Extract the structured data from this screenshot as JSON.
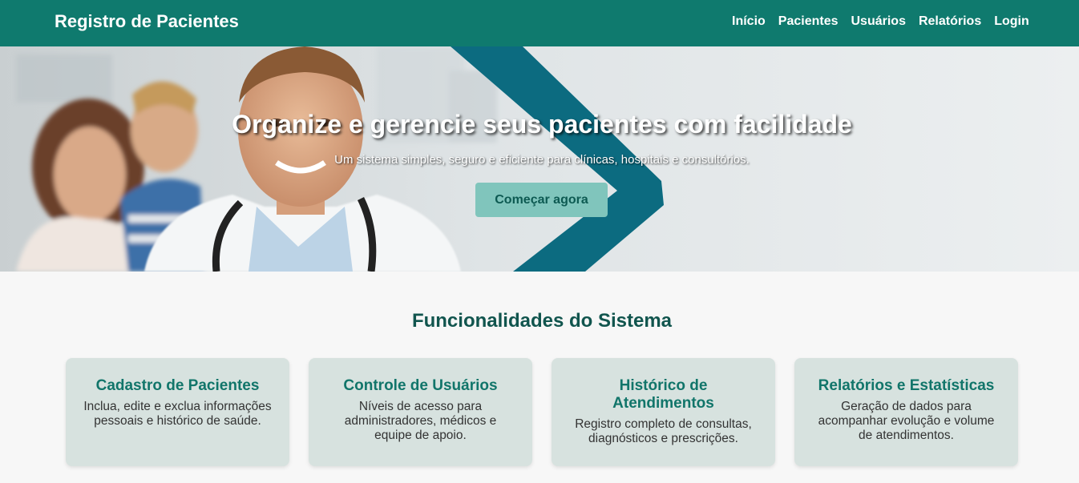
{
  "header": {
    "brand": "Registro de Pacientes",
    "nav": [
      "Início",
      "Pacientes",
      "Usuários",
      "Relatórios",
      "Login"
    ]
  },
  "hero": {
    "title": "Organize e gerencie seus pacientes com facilidade",
    "subtitle": "Um sistema simples, seguro e eficiente para clínicas, hospitais e consultórios.",
    "cta": "Começar agora"
  },
  "features": {
    "title": "Funcionalidades do Sistema",
    "cards": [
      {
        "title": "Cadastro de Pacientes",
        "text": "Inclua, edite e exclua informações pessoais e histórico de saúde."
      },
      {
        "title": "Controle de Usuários",
        "text": "Níveis de acesso para administradores, médicos e equipe de apoio."
      },
      {
        "title": "Histórico de Atendimentos",
        "text": "Registro completo de consultas, diagnósticos e prescrições."
      },
      {
        "title": "Relatórios e Estatísticas",
        "text": "Geração de dados para acompanhar evolução e volume de atendimentos."
      }
    ]
  },
  "colors": {
    "primary": "#0f7a6e",
    "cta_bg": "#80c5bc",
    "card_bg": "#d7e2df",
    "heading": "#11554e",
    "hero_accent": "#0c6b80"
  }
}
